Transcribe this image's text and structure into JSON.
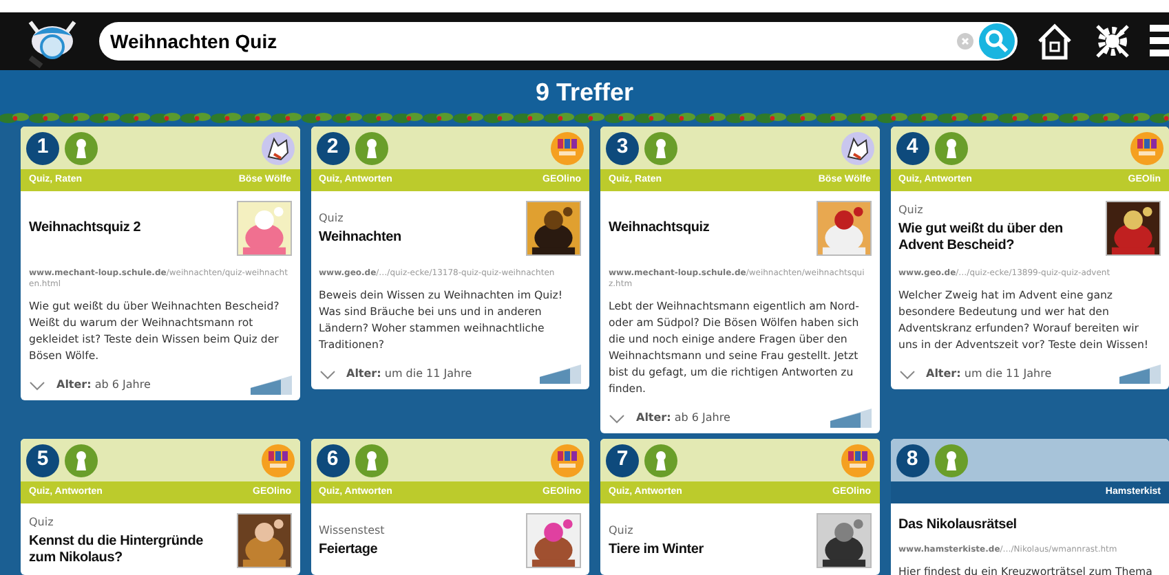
{
  "search": {
    "value": "Weihnachten Quiz"
  },
  "results_heading": "9 Treffer",
  "cards": [
    {
      "number": "1",
      "color": "#e3e9b3",
      "tags": "Quiz, Raten",
      "source": "Böse Wölfe",
      "logo": {
        "kind": "wolf"
      },
      "title": "Weihnachtsquiz 2",
      "url_domain": "www.mechant-loup.schule.de",
      "url_path": "/weihnachten/quiz-weihnachten.html",
      "description": "Wie gut weißt du über Weihnachten Bescheid? Weißt du warum der Weihnachtsmann rot gekleidet ist? Teste dein Wissen beim Quiz der Bösen Wölfe.",
      "age": "**Alter:** ab 6 Jahre"
    },
    {
      "number": "2",
      "color": "#e3e9b3",
      "tags": "Quiz, Antworten",
      "source": "GEOlino",
      "logo": {
        "kind": "geo"
      },
      "category": "Quiz",
      "title": "Weihnachten",
      "url_domain": "www.geo.de",
      "url_path": "/…/quiz-ecke/13178-quiz-quiz-weihnachten",
      "description": "Beweis dein Wissen zu Weihnachten im Quiz! Was sind Bräuche bei uns und in anderen Ländern? Woher stammen weihnachtliche Traditionen?",
      "age": "**Alter:** um die 11 Jahre"
    },
    {
      "number": "3",
      "color": "#e3e9b3",
      "tags": "Quiz, Raten",
      "source": "Böse Wölfe",
      "logo": {
        "kind": "wolf"
      },
      "title": "Weihnachtsquiz",
      "url_domain": "www.mechant-loup.schule.de",
      "url_path": "/weihnachten/weihnachtsquiz.htm",
      "description": "Lebt der Weihnachtsmann eigentlich am Nord- oder am Südpol? Die Bösen Wölfen haben sich die und noch einige andere Fragen über den Weihnachtsmann und seine Frau gestellt. Jetzt bist du gefagt, um die richtigen Antworten zu finden.",
      "age": "**Alter:** ab 6 Jahre"
    },
    {
      "number": "4",
      "color": "#e3e9b3",
      "tags": "Quiz, Antworten",
      "source": "GEOlin",
      "logo": {
        "kind": "geo"
      },
      "category": "Quiz",
      "title": "Wie gut weißt du über den Advent Bescheid?",
      "url_domain": "www.geo.de",
      "url_path": "/…/quiz-ecke/13899-quiz-quiz-advent",
      "description": "Welcher Zweig hat im Advent eine ganz besondere Bedeutung und wer hat den Adventskranz erfunden? Worauf bereiten wir uns in der Adventszeit vor? Teste dein Wissen!",
      "age": "**Alter:** um die 11 Jahre"
    },
    {
      "number": "5",
      "color": "#e3e9b3",
      "tags": "Quiz, Antworten",
      "source": "GEOlino",
      "logo": {
        "kind": "geo"
      },
      "category": "Quiz",
      "title": "Kennst du die Hintergründe zum Nikolaus?"
    },
    {
      "number": "6",
      "color": "#e3e9b3",
      "tags": "Quiz, Antworten",
      "source": "GEOlino",
      "logo": {
        "kind": "geo"
      },
      "category": "Wissenstest",
      "title": "Feiertage"
    },
    {
      "number": "7",
      "color": "#e3e9b3",
      "tags": "Quiz, Antworten",
      "source": "GEOlino",
      "logo": {
        "kind": "geo"
      },
      "category": "Quiz",
      "title": "Tiere im Winter"
    },
    {
      "number": "8",
      "color": "#a7c3d9",
      "source": "Hamsterkist",
      "title": "Das Nikolausrätsel",
      "url_domain": "www.hamsterkiste.de",
      "url_path": "/…/Nikolaus/wmannrast.htm",
      "description": "Hier findest du ein Kreuzworträtsel zum Thema"
    }
  ]
}
